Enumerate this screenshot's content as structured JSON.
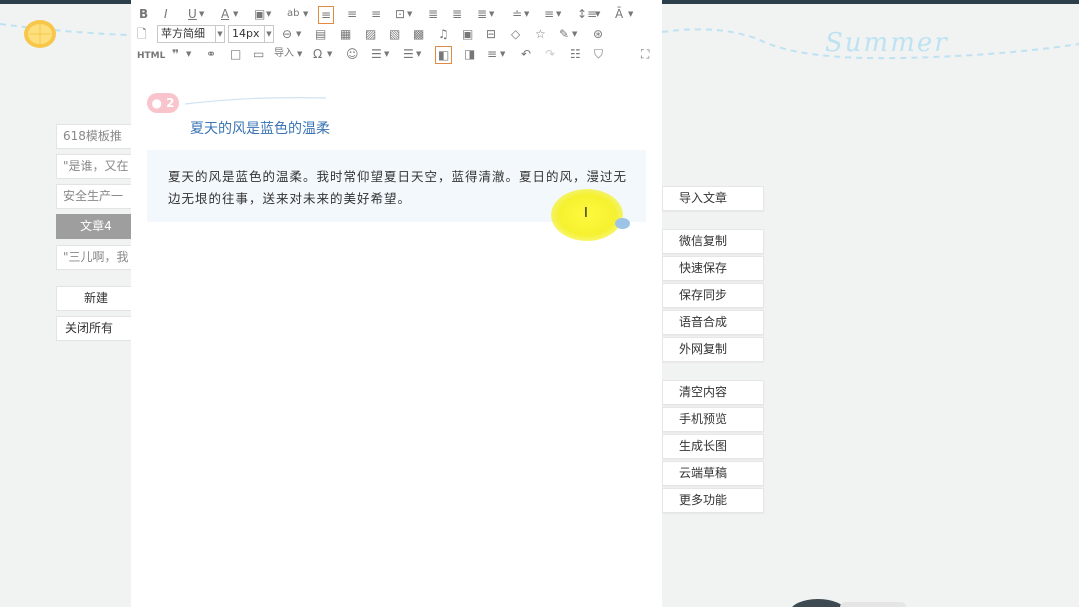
{
  "banner": {
    "title": "Summer"
  },
  "toolbar": {
    "row1": [
      "B",
      "I",
      "U",
      "A",
      "T",
      "ab",
      "≡",
      "≡",
      "≡",
      "≡",
      "≡",
      "≡",
      "≡",
      "≡",
      "≡",
      "↕",
      "A"
    ],
    "font_family": "苹方简细",
    "font_size": "14px",
    "html_label": "HTML",
    "import_label": "导入"
  },
  "sidebar": {
    "items": [
      {
        "label": "618模板推"
      },
      {
        "label": "\"是谁，又在"
      },
      {
        "label": "安全生产一"
      },
      {
        "label": "文章4"
      },
      {
        "label": "\"三儿啊，我"
      }
    ],
    "new_label": "新建",
    "close_all_label": "关闭所有"
  },
  "editor": {
    "badge": "2",
    "section_title": "夏天的风是蓝色的温柔",
    "body_text": "夏天的风是蓝色的温柔。我时常仰望夏日天空，蓝得清澈。夏日的风，漫过无边无垠的往事，送来对未来的美好希望。"
  },
  "right_panel": {
    "import_article": "导入文章",
    "group1": [
      "微信复制",
      "快速保存",
      "保存同步",
      "语音合成",
      "外网复制"
    ],
    "group2": [
      "清空内容",
      "手机预览",
      "生成长图",
      "云端草稿",
      "更多功能"
    ]
  },
  "colors": {
    "accent": "#3a74b5",
    "highlight": "#f5f130",
    "badge": "#f9c4cc"
  }
}
